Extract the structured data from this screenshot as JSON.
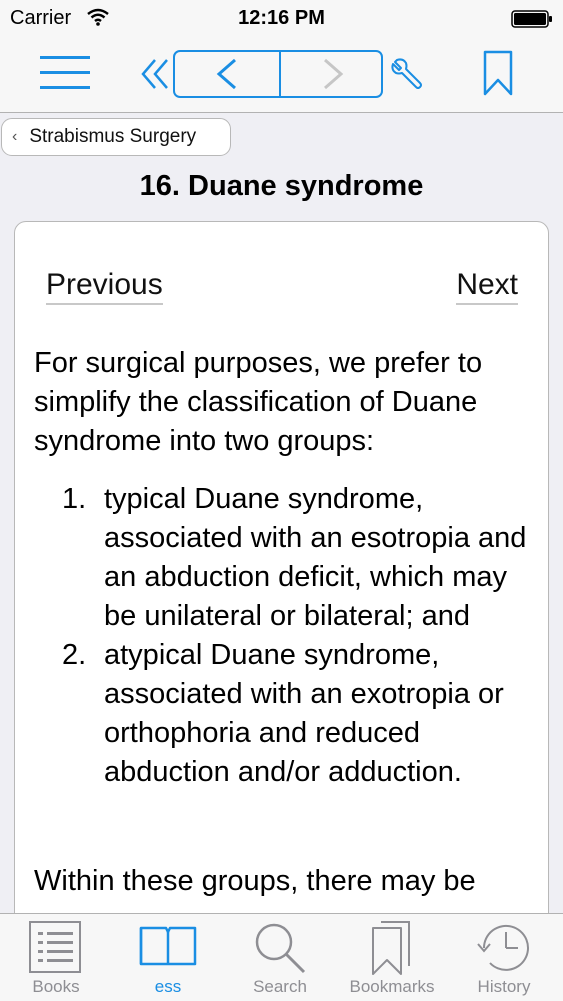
{
  "status_bar": {
    "carrier": "Carrier",
    "time": "12:16 PM"
  },
  "toolbar": {
    "menu_icon": "hamburger-menu-icon",
    "first_icon": "double-chevron-left-icon",
    "prev_icon": "chevron-left-icon",
    "next_icon": "chevron-right-icon",
    "tools_icon": "wrench-icon",
    "bookmark_icon": "bookmark-icon",
    "accent_color": "#1a8ee3"
  },
  "breadcrumb": {
    "label": "Strabismus Surgery"
  },
  "page": {
    "title": "16. Duane syndrome",
    "prev_link": "Previous",
    "next_link": "Next",
    "intro": "For surgical purposes, we prefer to simplify the classification of Duane syndrome into two groups:",
    "list": [
      {
        "num": "1.",
        "text": "typical Duane syndrome, associated with an esotropia and an abduction deficit, which may be unilateral or bilateral; and"
      },
      {
        "num": "2.",
        "text": "atypical Duane syndrome, associated with an exotropia or orthophoria and reduced abduction and/or adduction."
      }
    ],
    "outro": "Within these groups, there may be"
  },
  "tabbar": {
    "tabs": [
      {
        "label": "Books",
        "icon": "books-list-icon",
        "active": false
      },
      {
        "label": "ess",
        "icon": "open-book-icon",
        "active": true
      },
      {
        "label": "Search",
        "icon": "magnifier-icon",
        "active": false
      },
      {
        "label": "Bookmarks",
        "icon": "bookmarks-icon",
        "active": false
      },
      {
        "label": "History",
        "icon": "clock-icon",
        "active": false
      }
    ]
  }
}
